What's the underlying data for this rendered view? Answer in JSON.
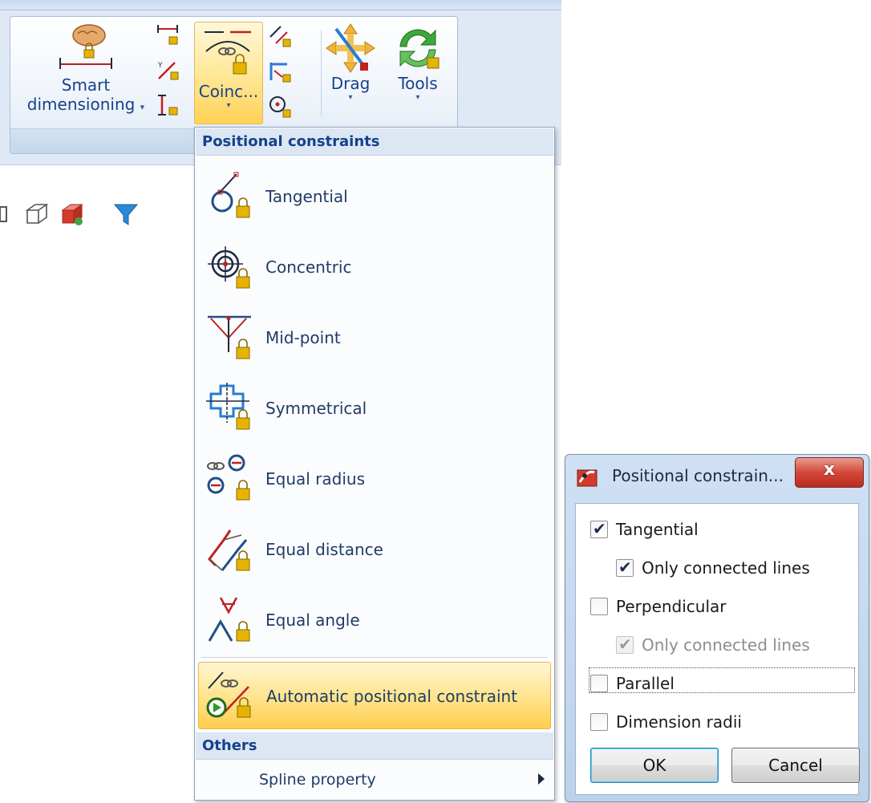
{
  "ribbon": {
    "smart_dimensioning": {
      "line1": "Smart",
      "line2": "dimensioning"
    },
    "coincidence": {
      "label": "Coinc..."
    },
    "drag": {
      "label": "Drag"
    },
    "tools": {
      "label": "Tools"
    }
  },
  "menu": {
    "section_positional": "Positional constraints",
    "items": [
      {
        "label": "Tangential",
        "icon": "tangential-icon"
      },
      {
        "label": "Concentric",
        "icon": "concentric-icon"
      },
      {
        "label": "Mid-point",
        "icon": "midpoint-icon"
      },
      {
        "label": "Symmetrical",
        "icon": "symmetrical-icon"
      },
      {
        "label": "Equal radius",
        "icon": "equal-radius-icon"
      },
      {
        "label": "Equal distance",
        "icon": "equal-distance-icon"
      },
      {
        "label": "Equal angle",
        "icon": "equal-angle-icon"
      }
    ],
    "auto_item": {
      "label": "Automatic positional constraint",
      "icon": "automatic-constraint-icon"
    },
    "section_others": "Others",
    "spline_property": "Spline property"
  },
  "dialog": {
    "title": "Positional constrain...",
    "close_glyph": "x",
    "checkboxes": [
      {
        "label": "Tangential",
        "checked": true,
        "enabled": true
      },
      {
        "label": "Only connected lines",
        "checked": true,
        "enabled": true
      },
      {
        "label": "Perpendicular",
        "checked": false,
        "enabled": true
      },
      {
        "label": "Only connected lines",
        "checked": true,
        "enabled": false
      },
      {
        "label": "Parallel",
        "checked": false,
        "enabled": true
      },
      {
        "label": "Dimension radii",
        "checked": false,
        "enabled": true
      }
    ],
    "ok_label": "OK",
    "cancel_label": "Cancel"
  },
  "colors": {
    "accent": "#15428b",
    "highlight": "#ffd257",
    "close": "#d4483a"
  }
}
